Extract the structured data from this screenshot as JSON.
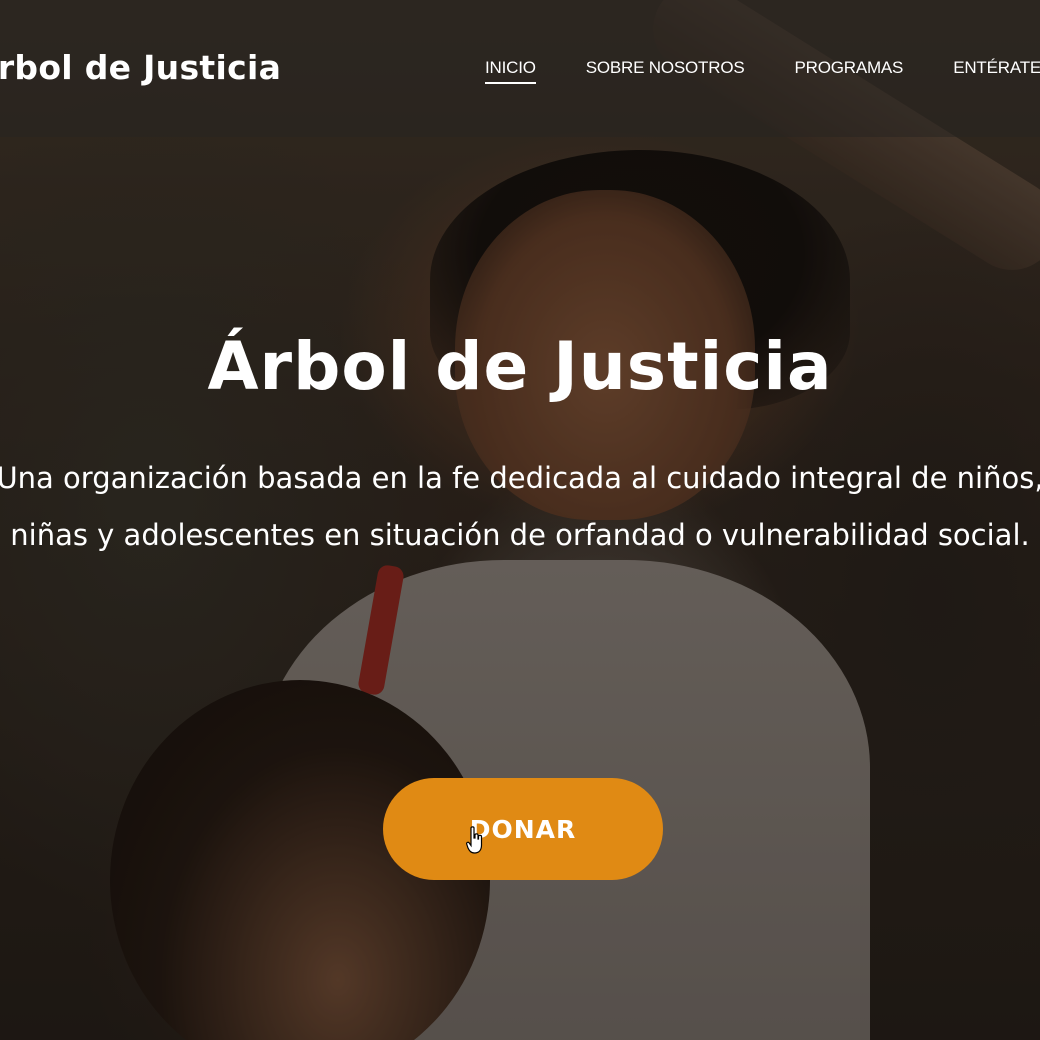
{
  "header": {
    "logo_text": "Árbol de Justicia",
    "nav": [
      {
        "label": "INICIO",
        "active": true
      },
      {
        "label": "SOBRE NOSOTROS",
        "active": false
      },
      {
        "label": "PROGRAMAS",
        "active": false
      },
      {
        "label": "ENTÉRATE",
        "active": false
      }
    ]
  },
  "hero": {
    "title": "Árbol de Justicia",
    "subtitle_line1": "Una organización basada en la fe dedicada al cuidado integral de niños,",
    "subtitle_line2": "niñas y adolescentes en situación de orfandad o vulnerabilidad social.",
    "donate_label": "DONAR"
  },
  "colors": {
    "accent": "#e08a14",
    "header_bg": "rgba(40,36,33,.55)",
    "text": "#ffffff"
  },
  "icons": {
    "cursor": "hand-pointer-icon"
  }
}
